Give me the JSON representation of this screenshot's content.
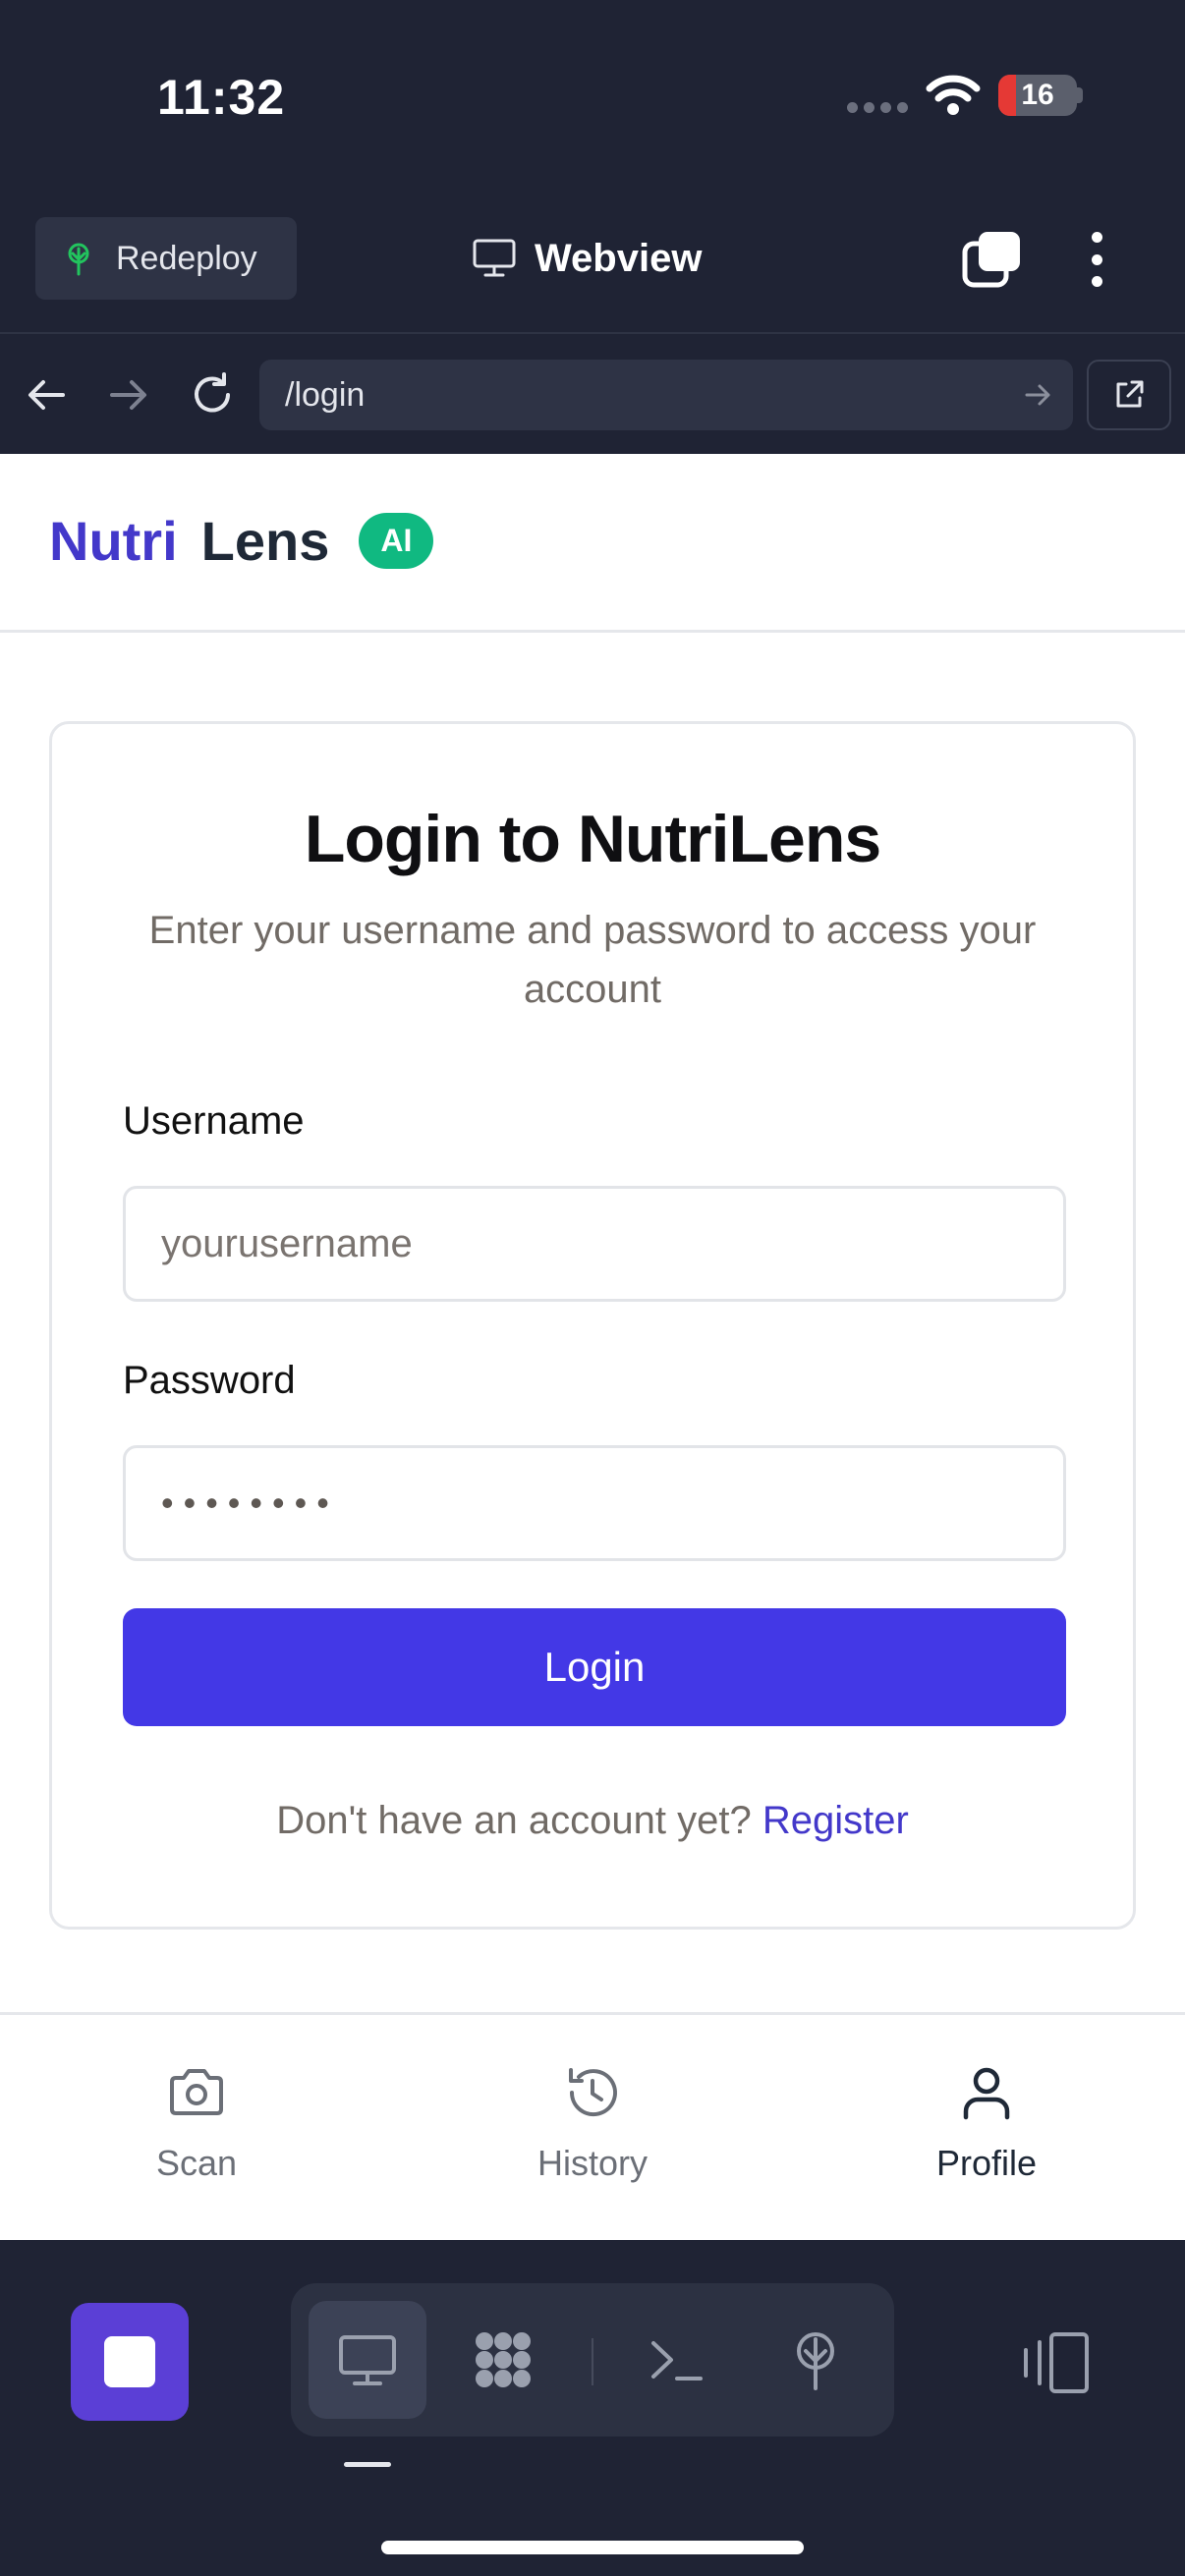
{
  "status_bar": {
    "time": "11:32",
    "battery": "16"
  },
  "toolbar": {
    "redeploy_label": "Redeploy",
    "title": "Webview"
  },
  "url_bar": {
    "url": "/login"
  },
  "site": {
    "brand_part1": "Nutri",
    "brand_part2": "Lens",
    "badge": "AI"
  },
  "login": {
    "title": "Login to NutriLens",
    "subtitle": "Enter your username and password to access your account",
    "username_label": "Username",
    "username_placeholder": "yourusername",
    "password_label": "Password",
    "password_value": "••••••••",
    "login_button": "Login",
    "register_prompt": "Don't have an account yet?",
    "register_link": "Register"
  },
  "bottom_nav": {
    "items": [
      {
        "label": "Scan",
        "icon": "camera-icon"
      },
      {
        "label": "History",
        "icon": "history-icon"
      },
      {
        "label": "Profile",
        "icon": "user-icon",
        "active": true
      }
    ]
  },
  "dock": {
    "items": [
      "monitor-icon",
      "apps-grid-icon",
      "terminal-icon",
      "deploy-icon"
    ],
    "active": "monitor-icon"
  },
  "colors": {
    "chrome_bg": "#1f2334",
    "brand_primary": "#4338ca",
    "button_primary": "#4338e6",
    "badge_green": "#10b981",
    "stop_button": "#5b3fd6"
  }
}
